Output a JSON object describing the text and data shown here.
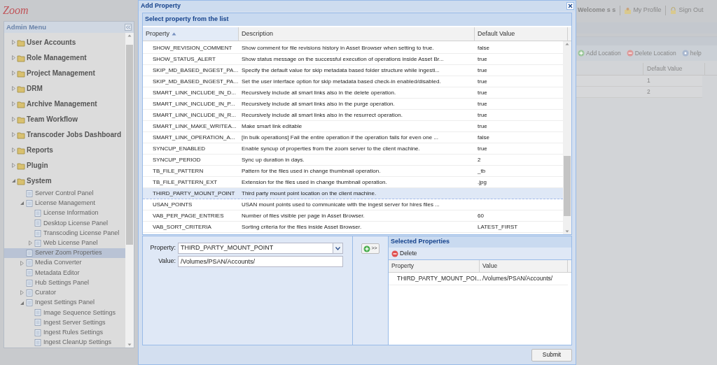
{
  "logo": {
    "text": "Zoom"
  },
  "header": {
    "welcome": "Welcome s s",
    "links": [
      "My Profile",
      "Sign Out"
    ]
  },
  "sidebar": {
    "title": "Admin Menu",
    "items": [
      {
        "label": "User Accounts",
        "expanded": false,
        "selected": false
      },
      {
        "label": "Role Management",
        "expanded": false,
        "selected": false
      },
      {
        "label": "Project Management",
        "expanded": false,
        "selected": false
      },
      {
        "label": "DRM",
        "expanded": false,
        "selected": false
      },
      {
        "label": "Archive Management",
        "expanded": false,
        "selected": false
      },
      {
        "label": "Team Workflow",
        "expanded": false,
        "selected": false
      },
      {
        "label": "Transcoder Jobs Dashboard",
        "expanded": false,
        "selected": false
      },
      {
        "label": "Reports",
        "expanded": false,
        "selected": false
      },
      {
        "label": "Plugin",
        "expanded": false,
        "selected": false
      },
      {
        "label": "System",
        "expanded": true,
        "selected": false,
        "children": [
          {
            "label": "Server Control Panel",
            "selected": false
          },
          {
            "label": "License Management",
            "expanded": true,
            "selected": false,
            "children": [
              {
                "label": "License Information",
                "selected": false
              },
              {
                "label": "Desktop License Panel",
                "selected": false
              },
              {
                "label": "Transcoding License Panel",
                "selected": false
              },
              {
                "label": "Web License Panel",
                "expanded": false,
                "selected": false
              }
            ]
          },
          {
            "label": "Server Zoom Properties",
            "selected": true
          },
          {
            "label": "Media Converter",
            "expanded": false,
            "selected": false
          },
          {
            "label": "Metadata Editor",
            "selected": false
          },
          {
            "label": "Hub Settings Panel",
            "selected": false
          },
          {
            "label": "Curator",
            "expanded": false,
            "selected": false
          },
          {
            "label": "Ingest Settings Panel",
            "expanded": true,
            "selected": false,
            "children": [
              {
                "label": "Image Sequence Settings",
                "selected": false
              },
              {
                "label": "Ingest Server Settings",
                "selected": false
              },
              {
                "label": "Ingest Rules Settings",
                "selected": false
              },
              {
                "label": "Ingest CleanUp Settings",
                "selected": false
              }
            ]
          }
        ]
      }
    ]
  },
  "background_panel": {
    "toolbar": [
      "Add Location",
      "Delete Location",
      "help"
    ],
    "column": "Default Value",
    "rows": [
      "1",
      "2"
    ]
  },
  "dialog": {
    "title": "Add Property",
    "list_panel": {
      "title": "Select property from the list",
      "columns": [
        {
          "label": "Property",
          "sorted": true
        },
        {
          "label": "Description",
          "sorted": false
        },
        {
          "label": "Default Value",
          "sorted": false
        }
      ],
      "rows": [
        {
          "property": "SHOW_REVISION_COMMENT",
          "description": "Show comment for file revisions history in Asset Browser when setting to true.",
          "default": "false",
          "selected": false
        },
        {
          "property": "SHOW_STATUS_ALERT",
          "description": "Show status message on the successful execution of operations inside Asset Br...",
          "default": "true",
          "selected": false
        },
        {
          "property": "SKIP_MD_BASED_INGEST_PA...",
          "description": "Specify the default value for skip metadata based folder structure while ingesti...",
          "default": "true",
          "selected": false
        },
        {
          "property": "SKIP_MD_BASED_INGEST_PA...",
          "description": "Set the user interface option for skip metadata based check-in enabled/disabled.",
          "default": "true",
          "selected": false
        },
        {
          "property": "SMART_LINK_INCLUDE_IN_D...",
          "description": "Recursively include all smart links also in the delete operation.",
          "default": "true",
          "selected": false
        },
        {
          "property": "SMART_LINK_INCLUDE_IN_P...",
          "description": "Recursively include all smart links also in the purge operation.",
          "default": "true",
          "selected": false
        },
        {
          "property": "SMART_LINK_INCLUDE_IN_R...",
          "description": "Recursively include all smart links also in the resurrect operation.",
          "default": "true",
          "selected": false
        },
        {
          "property": "SMART_LINK_MAKE_WRITEA...",
          "description": "Make smart link editable",
          "default": "true",
          "selected": false
        },
        {
          "property": "SMART_LINK_OPERATION_A...",
          "description": "[In bulk operations] Fail the entire operation if the operation fails for even one ...",
          "default": "false",
          "selected": false
        },
        {
          "property": "SYNCUP_ENABLED",
          "description": "Enable syncup of properties from the zoom server to the client machine.",
          "default": "true",
          "selected": false
        },
        {
          "property": "SYNCUP_PERIOD",
          "description": "Sync up duration in days.",
          "default": "2",
          "selected": false
        },
        {
          "property": "TB_FILE_PATTERN",
          "description": "Pattern for the files used in change thumbnail operation.",
          "default": "_tb",
          "selected": false
        },
        {
          "property": "TB_FILE_PATTERN_EXT",
          "description": "Extension for the files used in change thumbnail operation.",
          "default": ".jpg",
          "selected": false
        },
        {
          "property": "THIRD_PARTY_MOUNT_POINT",
          "description": "Third party mount point location on the client machine.",
          "selected": true
        },
        {
          "property": "USAN_POINTS",
          "description": "USAN mount points used to communicate with the ingest server for hires files ...",
          "selected": false
        },
        {
          "property": "VAB_PER_PAGE_ENTRIES",
          "description": "Number of files visible per page in Asset Browser.",
          "default": "60",
          "selected": false
        },
        {
          "property": "VAB_SORT_CRITERIA",
          "description": "Sorting criteria for the files inside Asset Browser.",
          "default": "LATEST_FIRST",
          "selected": false
        }
      ]
    },
    "form": {
      "property_label": "Property:",
      "property_value": "THIRD_PARTY_MOUNT_POINT",
      "value_label": "Value:",
      "value": "/Volumes/PSAN/Accounts/"
    },
    "add_button": ">>",
    "selected_panel": {
      "title": "Selected Properties",
      "delete": "Delete",
      "columns": [
        "Property",
        "Value"
      ],
      "rows": [
        {
          "property": "THIRD_PARTY_MOUNT_POI...",
          "value": "/Volumes/PSAN/Accounts/"
        }
      ]
    },
    "submit": "Submit"
  }
}
